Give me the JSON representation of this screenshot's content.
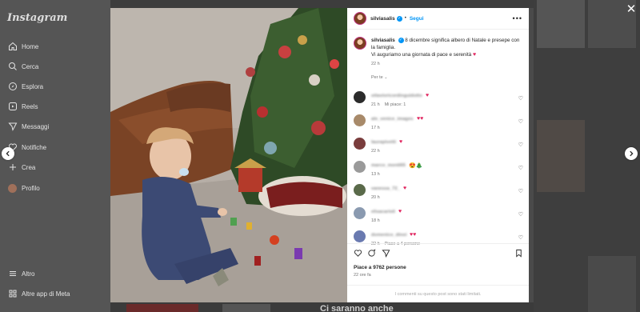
{
  "sidebar": {
    "brand": "Instagram",
    "items": [
      {
        "label": "Home",
        "icon": "home-icon"
      },
      {
        "label": "Cerca",
        "icon": "search-icon"
      },
      {
        "label": "Esplora",
        "icon": "compass-icon"
      },
      {
        "label": "Reels",
        "icon": "reels-icon"
      },
      {
        "label": "Messaggi",
        "icon": "send-icon"
      },
      {
        "label": "Notifiche",
        "icon": "heart-icon"
      },
      {
        "label": "Crea",
        "icon": "plus-icon"
      },
      {
        "label": "Profilo",
        "icon": "avatar-icon"
      }
    ],
    "more": "Altro",
    "meta_apps": "Altre app di Meta"
  },
  "background": {
    "caption": "Ci saranno anche"
  },
  "post": {
    "username": "silviasalis",
    "follow_label": "Segui",
    "caption_line1": "8 dicembre significa albero di Natale e presepe con la famiglia.",
    "caption_line2": "Vi auguriamo una giornata di pace e serenità",
    "caption_time": "22 h",
    "translate_label": "Per te",
    "comments": [
      {
        "name": "ottavioricordinguidotto",
        "emoji": "♥",
        "time": "21 h",
        "extra": "Mi piace: 1",
        "avatar": "#2b2b2b"
      },
      {
        "name": "ale_venice_images",
        "emoji": "♥♥",
        "time": "17 h",
        "extra": "",
        "avatar": "#a88a6a"
      },
      {
        "name": "laurapivetti",
        "emoji": "♥",
        "time": "22 h",
        "extra": "",
        "avatar": "#7a3d3d"
      },
      {
        "name": "marco_monti65",
        "emoji": "😍🎄",
        "time": "13 h",
        "extra": "",
        "avatar": "#9a9a9a"
      },
      {
        "name": "vanessa_72_",
        "emoji": "♥",
        "time": "20 h",
        "extra": "",
        "avatar": "#5a6a4a"
      },
      {
        "name": "elisacarioli",
        "emoji": "♥",
        "time": "18 h",
        "extra": "",
        "avatar": "#8a9ab0"
      },
      {
        "name": "domenico_dinoi",
        "emoji": "♥♥",
        "time": "22 h",
        "extra": "Piace a 4 persone",
        "avatar": "#6a7ab0"
      }
    ],
    "likes": "Piace a 9762 persone",
    "posted_ago": "22 ore fa",
    "comments_limited": "I commenti su questo post sono stati limitati."
  },
  "colors": {
    "accent": "#0095f6",
    "heart": "#e0245e",
    "overlay": "#4a4a4a"
  }
}
